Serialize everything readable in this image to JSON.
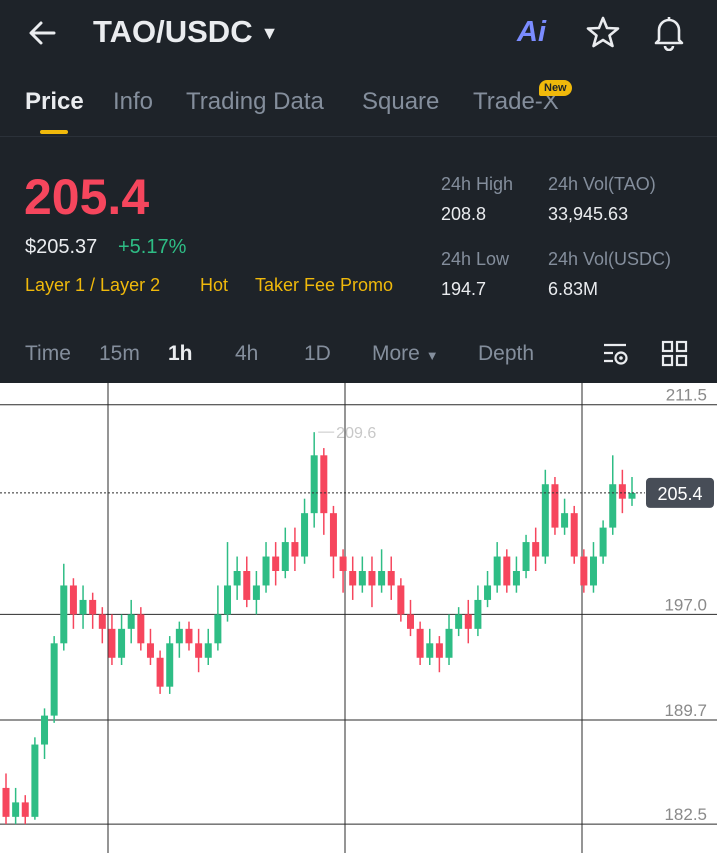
{
  "header": {
    "pair": "TAO/USDC",
    "ai_label": "Ai"
  },
  "tabs": [
    {
      "label": "Price"
    },
    {
      "label": "Info"
    },
    {
      "label": "Trading Data"
    },
    {
      "label": "Square"
    },
    {
      "label": "Trade-X",
      "badge": "New"
    }
  ],
  "price": {
    "last": "205.4",
    "usd": "$205.37",
    "change": "+5.17%",
    "tags": [
      "Layer 1 / Layer 2",
      "Hot",
      "Taker Fee Promo"
    ]
  },
  "stats": {
    "high_label": "24h High",
    "high": "208.8",
    "low_label": "24h Low",
    "low": "194.7",
    "vol_base_label": "24h Vol(TAO)",
    "vol_base": "33,945.63",
    "vol_quote_label": "24h Vol(USDC)",
    "vol_quote": "6.83M"
  },
  "timeframes": [
    "Time",
    "15m",
    "1h",
    "4h",
    "1D",
    "More",
    "Depth"
  ],
  "active_timeframe": "1h",
  "chart_data": {
    "type": "candlestick",
    "y_ticks": [
      "211.5",
      "197.0",
      "189.7",
      "182.5"
    ],
    "ylim": [
      180.5,
      213.0
    ],
    "high_marker": "209.6",
    "last_price_label": "205.4",
    "colors": {
      "up": "#2ebd85",
      "down": "#f6465d"
    },
    "candles": [
      [
        185,
        183,
        186,
        182.5
      ],
      [
        183,
        184,
        185,
        182.5
      ],
      [
        184,
        183,
        184.5,
        182.5
      ],
      [
        183,
        188,
        188.5,
        182.8
      ],
      [
        188,
        190,
        190.5,
        187
      ],
      [
        190,
        195,
        195.5,
        189.5
      ],
      [
        195,
        199,
        200.5,
        194.5
      ],
      [
        199,
        197,
        199.5,
        196
      ],
      [
        197,
        198,
        199,
        196
      ],
      [
        198,
        197,
        198.5,
        196
      ],
      [
        197,
        196,
        197.5,
        195
      ],
      [
        196,
        194,
        197,
        193.5
      ],
      [
        194,
        196,
        197,
        193.5
      ],
      [
        196,
        197,
        198,
        195
      ],
      [
        197,
        195,
        197.5,
        194.5
      ],
      [
        195,
        194,
        196,
        193.5
      ],
      [
        194,
        192,
        194.5,
        191.5
      ],
      [
        192,
        195,
        195.5,
        191.5
      ],
      [
        195,
        196,
        196.5,
        194
      ],
      [
        196,
        195,
        196.5,
        194.5
      ],
      [
        195,
        194,
        196,
        193
      ],
      [
        194,
        195,
        196,
        193.5
      ],
      [
        195,
        197,
        199,
        194.5
      ],
      [
        197,
        199,
        202,
        196.5
      ],
      [
        199,
        200,
        201,
        198
      ],
      [
        200,
        198,
        201,
        197.5
      ],
      [
        198,
        199,
        200,
        197
      ],
      [
        199,
        201,
        202,
        198.5
      ],
      [
        201,
        200,
        202,
        199
      ],
      [
        200,
        202,
        203,
        199.5
      ],
      [
        202,
        201,
        203,
        200
      ],
      [
        201,
        204,
        205,
        200.5
      ],
      [
        204,
        208,
        209.6,
        203
      ],
      [
        208,
        204,
        208.5,
        202.5
      ],
      [
        204,
        201,
        204.5,
        199.5
      ],
      [
        201,
        200,
        201.5,
        198.5
      ],
      [
        200,
        199,
        201,
        198
      ],
      [
        199,
        200,
        201,
        198.5
      ],
      [
        200,
        199,
        201,
        197.5
      ],
      [
        199,
        200,
        201.5,
        198.5
      ],
      [
        200,
        199,
        201,
        198
      ],
      [
        199,
        197,
        199.5,
        196.5
      ],
      [
        197,
        196,
        198,
        195.5
      ],
      [
        196,
        194,
        196.5,
        193.5
      ],
      [
        194,
        195,
        196,
        193.5
      ],
      [
        195,
        194,
        195.5,
        193
      ],
      [
        194,
        196,
        197,
        193.5
      ],
      [
        196,
        197,
        197.5,
        195.5
      ],
      [
        197,
        196,
        198,
        195
      ],
      [
        196,
        198,
        199,
        195.5
      ],
      [
        198,
        199,
        200,
        197.5
      ],
      [
        199,
        201,
        202,
        198.5
      ],
      [
        201,
        199,
        201.5,
        198.5
      ],
      [
        199,
        200,
        201,
        198.5
      ],
      [
        200,
        202,
        202.5,
        199.5
      ],
      [
        202,
        201,
        203,
        200
      ],
      [
        201,
        206,
        207,
        200.5
      ],
      [
        206,
        203,
        206.5,
        202.5
      ],
      [
        203,
        204,
        205,
        202.5
      ],
      [
        204,
        201,
        204.5,
        200.5
      ],
      [
        201,
        199,
        201.5,
        198.5
      ],
      [
        199,
        201,
        202,
        198.5
      ],
      [
        201,
        203,
        203.5,
        200.5
      ],
      [
        203,
        206,
        208,
        202.5
      ],
      [
        206,
        205,
        207,
        204
      ],
      [
        205,
        205.4,
        206.5,
        204.5
      ]
    ]
  }
}
